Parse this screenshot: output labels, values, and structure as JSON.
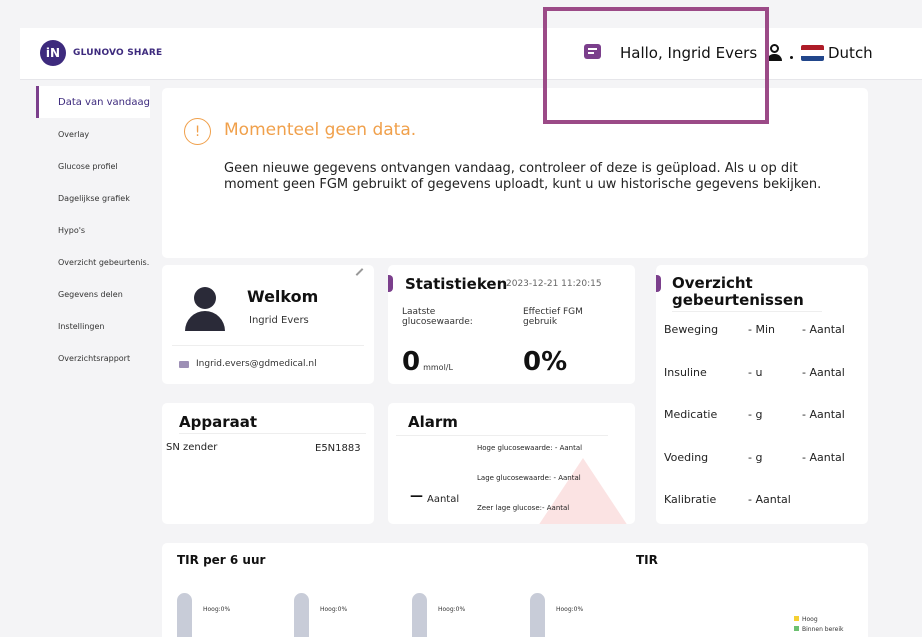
{
  "header": {
    "logo_mark": "iN",
    "logo_text": "GLUNOVO SHARE",
    "greeting": "Hallo, Ingrid Evers",
    "language": "Dutch",
    "icons": [
      "chat-icon",
      "user-icon",
      "flag-nl-icon"
    ]
  },
  "sidebar": {
    "items": [
      {
        "label": "Data van vandaag",
        "active": true
      },
      {
        "label": "Overlay"
      },
      {
        "label": "Glucose profiel"
      },
      {
        "label": "Dagelijkse grafiek"
      },
      {
        "label": "Hypo's"
      },
      {
        "label": "Overzicht gebeurtenis..."
      },
      {
        "label": "Gegevens delen"
      },
      {
        "label": "Instellingen"
      },
      {
        "label": "Overzichtsrapport"
      }
    ]
  },
  "nodata": {
    "icon": "!",
    "title": "Momenteel geen data.",
    "message": "Geen nieuwe gegevens ontvangen vandaag, controleer of deze is geüpload. Als u op dit moment geen FGM gebruikt of gegevens uploadt, kunt u uw historische gegevens bekijken."
  },
  "welcome": {
    "title": "Welkom",
    "name": "Ingrid Evers",
    "email": "Ingrid.evers@gdmedical.nl"
  },
  "stats": {
    "title": "Statistieken",
    "timestamp": "2023-12-21 11:20:15",
    "glucose_label": "Laatste glucosewaarde:",
    "glucose_value": "0",
    "glucose_unit": "mmol/L",
    "fgm_label": "Effectief FGM gebruik",
    "fgm_value": "0%"
  },
  "events": {
    "title": "Overzicht gebeurtenissen",
    "rows": [
      {
        "label": "Beweging",
        "unit": "- Min",
        "count": "- Aantal"
      },
      {
        "label": "Insuline",
        "unit": "- u",
        "count": "- Aantal"
      },
      {
        "label": "Medicatie",
        "unit": "- g",
        "count": "- Aantal"
      },
      {
        "label": "Voeding",
        "unit": "- g",
        "count": "- Aantal"
      },
      {
        "label": "Kalibratie",
        "unit": "- Aantal",
        "count": ""
      }
    ]
  },
  "device": {
    "title": "Apparaat",
    "sn_label": "SN zender",
    "sn_value": "E5N1883"
  },
  "alarm": {
    "title": "Alarm",
    "dash": "—",
    "count_label": "Aantal",
    "high": "Hoge glucosewaarde: - Aantal",
    "low": "Lage glucosewaarde: - Aantal",
    "very_low": "Zeer lage glucose:- Aantal"
  },
  "tir": {
    "title_6h": "TIR per 6 uur",
    "title": "TIR",
    "bars": [
      {
        "label": "Hoog:0%"
      },
      {
        "label": "Hoog:0%"
      },
      {
        "label": "Hoog:0%"
      },
      {
        "label": "Hoog:0%"
      }
    ],
    "legend": [
      {
        "label": "Hoog",
        "color": "#f5d033"
      },
      {
        "label": "Binnen bereik",
        "color": "#6cc070"
      }
    ]
  },
  "colors": {
    "accent": "#7b3f8c",
    "warning": "#f0a04b",
    "highlight_box": "#9b4a87"
  }
}
